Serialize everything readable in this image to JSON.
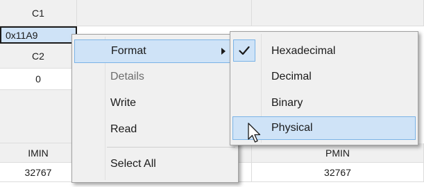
{
  "grid": {
    "header_c1": "C1",
    "selected_value": "0x11A9",
    "header_c2": "C2",
    "value_c2": "0",
    "header_imin": "IMIN",
    "value_imin": "32767",
    "header_pmin": "PMIN",
    "value_pmin": "32767"
  },
  "context_menu": {
    "items": [
      {
        "label": "Format",
        "state": "highlighted",
        "has_submenu": true
      },
      {
        "label": "Details",
        "state": "disabled"
      },
      {
        "label": "Write",
        "state": "normal"
      },
      {
        "label": "Read",
        "state": "normal"
      },
      {
        "label": "Select All",
        "state": "normal"
      }
    ]
  },
  "format_submenu": {
    "items": [
      {
        "label": "Hexadecimal",
        "checked": true
      },
      {
        "label": "Decimal",
        "checked": false
      },
      {
        "label": "Binary",
        "checked": false
      },
      {
        "label": "Physical",
        "checked": false,
        "state": "highlighted"
      }
    ]
  },
  "colors": {
    "menu_bg": "#f0f0f0",
    "highlight_bg": "#cfe3f7",
    "highlight_border": "#7ab3e6",
    "selected_cell_border": "#1a1a1a",
    "disabled_text": "#6d6d6d"
  },
  "icons": {
    "submenu_arrow": "chevron-right-icon",
    "checkmark": "check-icon",
    "cursor": "mouse-pointer-icon"
  }
}
